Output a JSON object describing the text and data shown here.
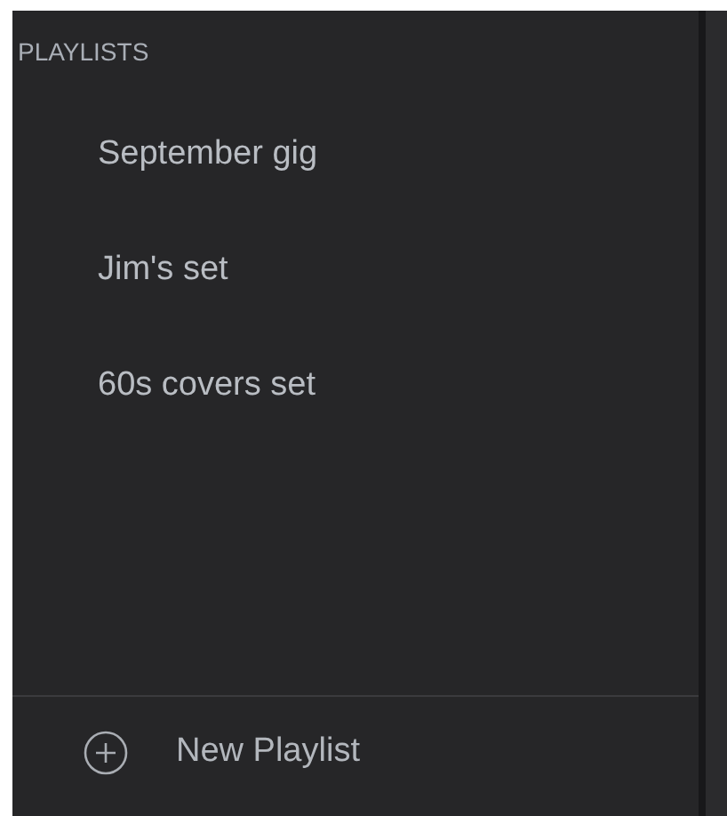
{
  "sidebar": {
    "heading": "PLAYLISTS",
    "items": [
      {
        "label": "September gig"
      },
      {
        "label": "Jim's set"
      },
      {
        "label": "60s covers set"
      }
    ],
    "new_button": {
      "label": "New Playlist"
    }
  }
}
